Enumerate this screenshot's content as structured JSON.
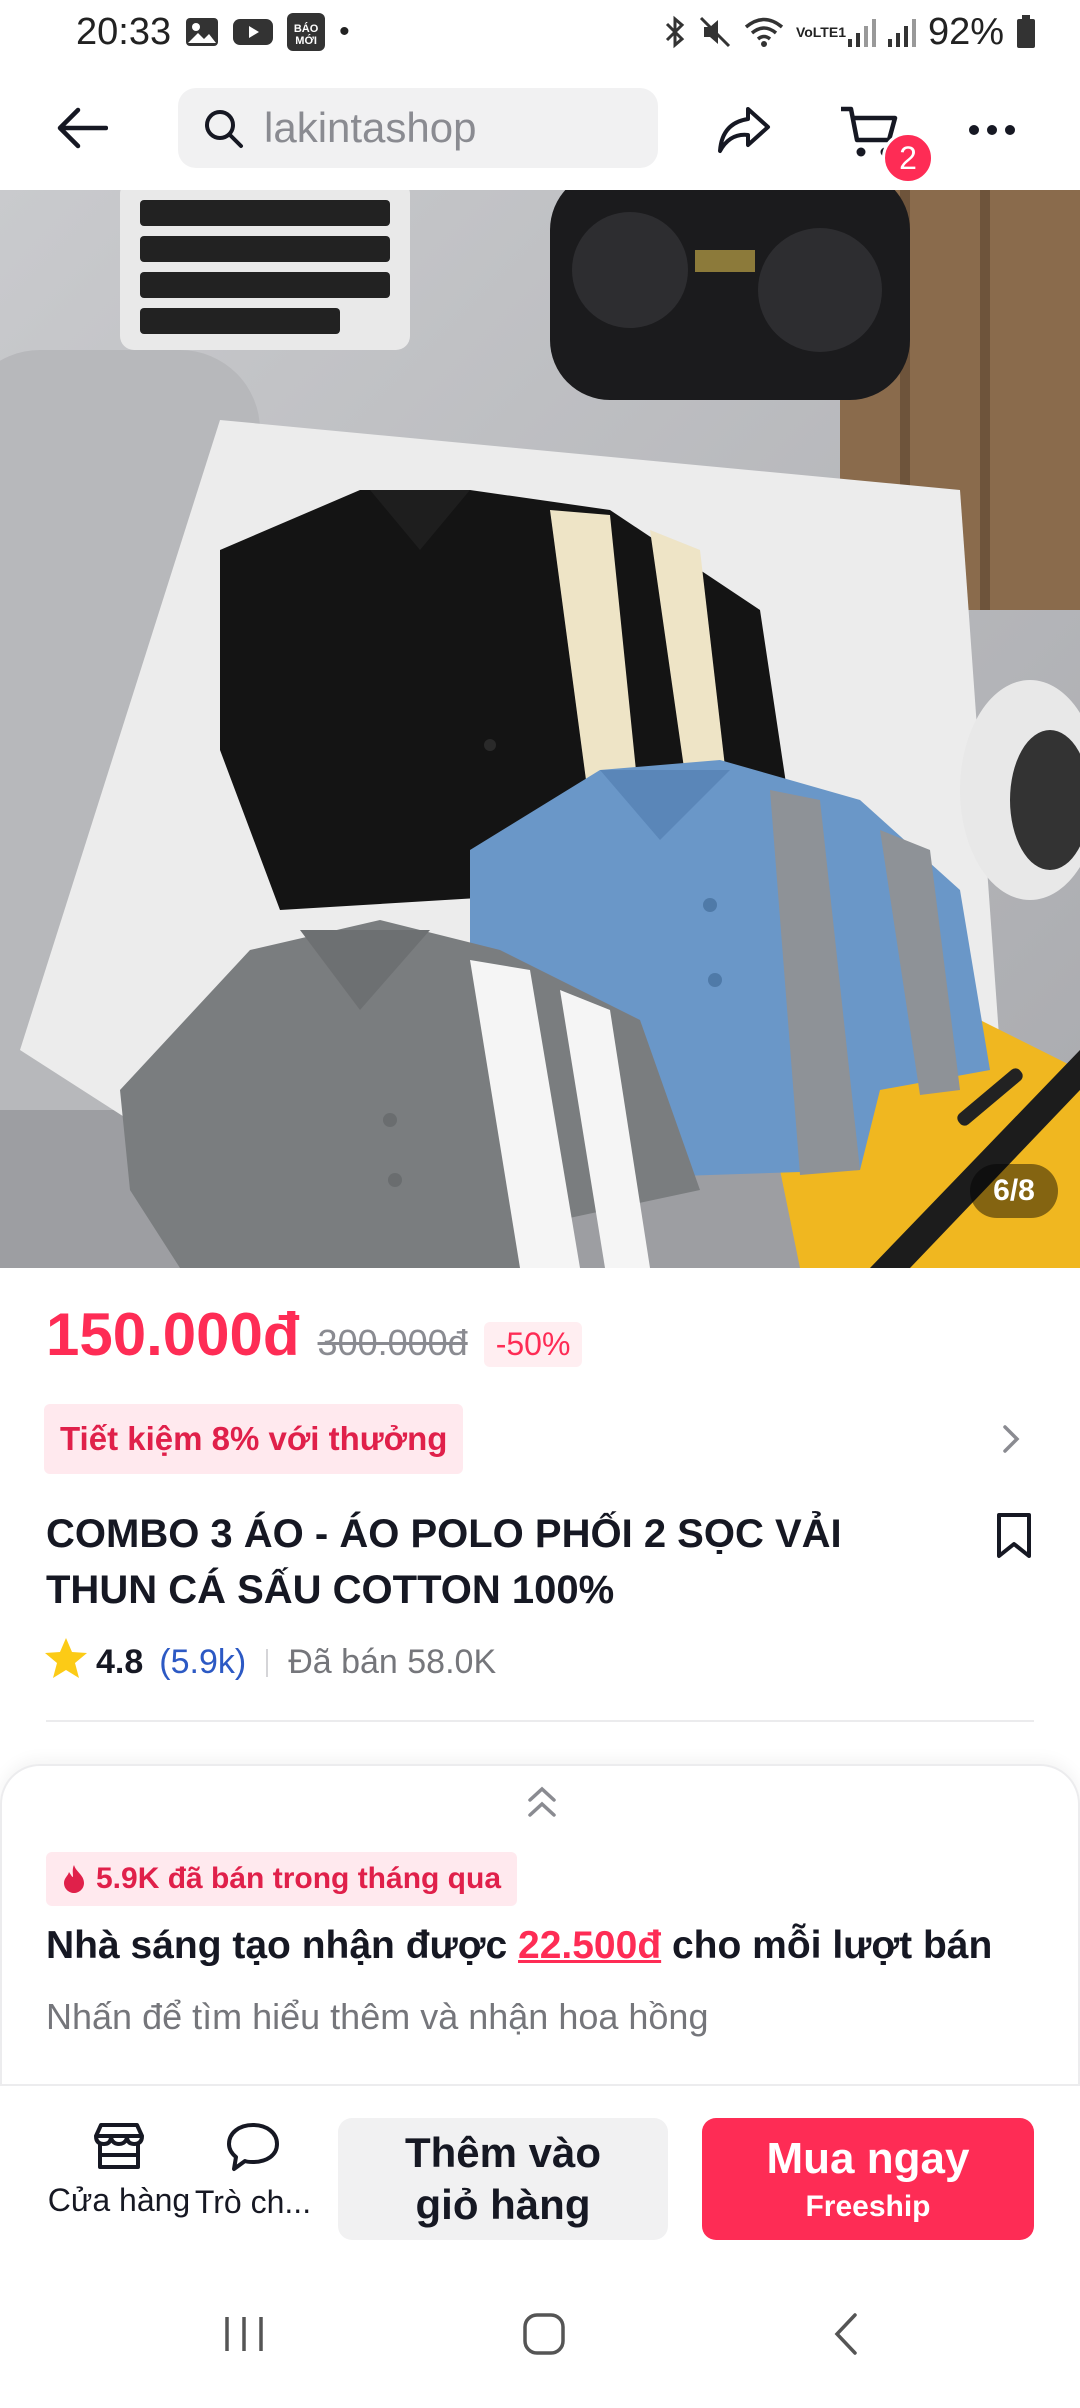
{
  "status_bar": {
    "time": "20:33",
    "baomoi_label": "BÁO MỚI",
    "dot": "•",
    "network_label": "VoLTE1",
    "battery": "92%"
  },
  "nav": {
    "search_text": "lakintashop",
    "cart_badge": "2"
  },
  "gallery": {
    "counter": "6/8"
  },
  "product": {
    "price": "150.000đ",
    "original_price": "300.000đ",
    "discount": "-50%",
    "reward": "Tiết kiệm 8% với thưởng",
    "title": "COMBO 3 ÁO - ÁO POLO PHỐI 2 SỌC VẢI THUN CÁ SẤU COTTON 100%",
    "rating": "4.8",
    "rating_count": "(5.9k)",
    "sold": "Đã bán 58.0K"
  },
  "affiliate": {
    "hot_tag": "5.9K đã bán trong tháng qua",
    "earn_prefix": "Nhà sáng tạo nhận được ",
    "earn_amount": "22.500đ",
    "earn_suffix": " cho mỗi lượt bán",
    "subtitle": "Nhấn để tìm hiểu thêm và nhận hoa hồng"
  },
  "actions": {
    "shop_label": "Cửa hàng",
    "chat_label": "Trò ch...",
    "add_to_cart": "Thêm vào giỏ hàng",
    "buy_now": "Mua ngay",
    "buy_sub": "Freeship"
  },
  "colors": {
    "accent": "#fe2c55",
    "text": "#161823",
    "muted": "#75767b",
    "link": "#2c59c4"
  }
}
